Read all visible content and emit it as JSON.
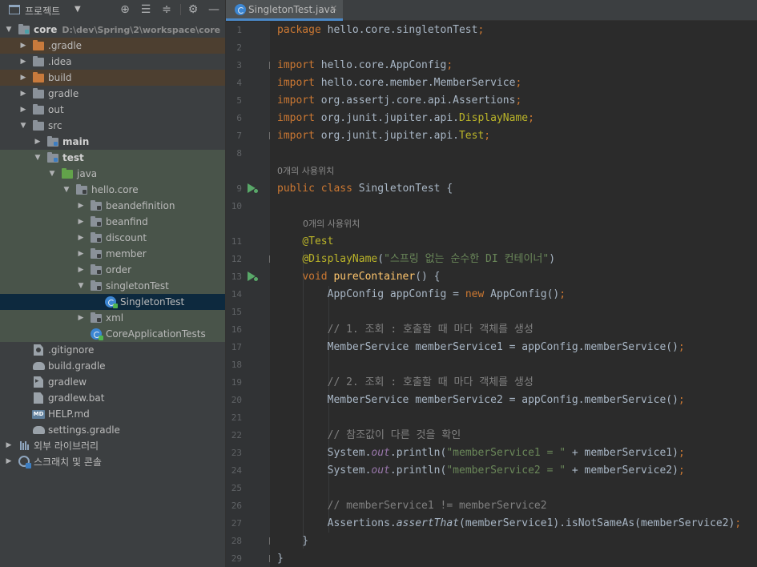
{
  "project": {
    "title": "프로젝트",
    "tree": [
      {
        "label": "core",
        "hint": "D:\\dev\\Spring\\2\\workspace\\core"
      },
      {
        "label": ".gradle"
      },
      {
        "label": ".idea"
      },
      {
        "label": "build"
      },
      {
        "label": "gradle"
      },
      {
        "label": "out"
      },
      {
        "label": "src"
      },
      {
        "label": "main"
      },
      {
        "label": "test"
      },
      {
        "label": "java"
      },
      {
        "label": "hello.core"
      },
      {
        "label": "beandefinition"
      },
      {
        "label": "beanfind"
      },
      {
        "label": "discount"
      },
      {
        "label": "member"
      },
      {
        "label": "order"
      },
      {
        "label": "singletonTest"
      },
      {
        "label": "SingletonTest"
      },
      {
        "label": "xml"
      },
      {
        "label": "CoreApplicationTests"
      },
      {
        "label": ".gitignore"
      },
      {
        "label": "build.gradle"
      },
      {
        "label": "gradlew"
      },
      {
        "label": "gradlew.bat"
      },
      {
        "label": "HELP.md"
      },
      {
        "label": "settings.gradle"
      },
      {
        "label": "외부 라이브러리"
      },
      {
        "label": "스크래치 및 콘솔"
      }
    ]
  },
  "editor": {
    "tab_label": "SingletonTest.java",
    "usage_hint_class": "0개의 사용위치",
    "usage_hint_method": "0개의 사용위치",
    "line_numbers": [
      "1",
      "2",
      "3",
      "4",
      "5",
      "6",
      "7",
      "8",
      "9",
      "10",
      "11",
      "12",
      "13",
      "14",
      "15",
      "16",
      "17",
      "18",
      "19",
      "20",
      "21",
      "22",
      "23",
      "24",
      "25",
      "26",
      "27",
      "28",
      "29"
    ],
    "code": {
      "l1_pkg": "hello.core.singletonTest",
      "l3": "hello.core.AppConfig",
      "l4": "hello.core.member.MemberService",
      "l5": "org.assertj.core.api.Assertions",
      "l6_pre": "org.junit.jupiter.api.",
      "l6_cls": "DisplayName",
      "l7_pre": "org.junit.jupiter.api.",
      "l7_cls": "Test",
      "l9_name": "SingletonTest",
      "l11": "@Test",
      "l12_ann": "@DisplayName",
      "l12_str": "\"스프링 없는 순수한 DI 컨테이너\"",
      "l13_fn": "pureContainer",
      "l14_type": "AppConfig appConfig = ",
      "l14_new_type": "AppConfig",
      "l16": "// 1. 조회 : 호출할 때 마다 객체를 생성",
      "l17": "MemberService memberService1 = appConfig.memberService()",
      "l19": "// 2. 조회 : 호출할 때 마다 객체를 생성",
      "l20": "MemberService memberService2 = appConfig.memberService()",
      "l22": "// 참조값이 다른 것을 확인",
      "l23_str": "\"memberService1 = \"",
      "l23_tail": " + memberService1)",
      "l24_str": "\"memberService2 = \"",
      "l24_tail": " + memberService2)",
      "l26": "// memberService1 != memberService2",
      "l27_pre": "Assertions.",
      "l27_fn": "assertThat",
      "l27_tail": "(memberService1).isNotSameAs(memberService2)"
    }
  }
}
